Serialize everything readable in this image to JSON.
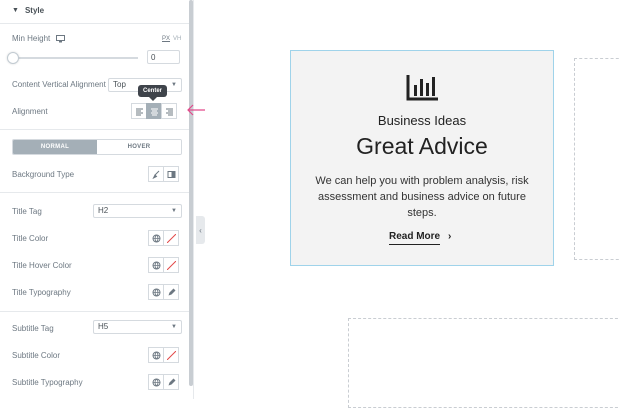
{
  "panel": {
    "section_title": "Style",
    "min_height": {
      "label": "Min Height",
      "unit_px": "PX",
      "unit_vh": "VH",
      "value": "0"
    },
    "content_vertical_alignment": {
      "label": "Content Vertical Alignment",
      "value": "Top"
    },
    "alignment": {
      "label": "Alignment",
      "tooltip": "Center",
      "selected": "center"
    },
    "state_tabs": {
      "normal": "NORMAL",
      "hover": "HOVER",
      "active": "normal"
    },
    "background_type": {
      "label": "Background Type"
    },
    "title_tag": {
      "label": "Title Tag",
      "value": "H2"
    },
    "title_color": {
      "label": "Title Color"
    },
    "title_hover_color": {
      "label": "Title Hover Color"
    },
    "title_typography": {
      "label": "Title Typography"
    },
    "subtitle_tag": {
      "label": "Subtitle Tag",
      "value": "H5"
    },
    "subtitle_color": {
      "label": "Subtitle Color"
    },
    "subtitle_typography": {
      "label": "Subtitle Typography"
    }
  },
  "card": {
    "icon": "bar-chart-icon",
    "subtitle": "Business Ideas",
    "title": "Great Advice",
    "text": "We can help you with problem analysis, risk assessment and business advice on future steps.",
    "link_label": "Read More",
    "link_icon": "chevron-right-icon"
  },
  "colors": {
    "accent_pointer": "#e2498a",
    "card_border": "#9fd3ea",
    "active_control": "#a4afb7"
  }
}
